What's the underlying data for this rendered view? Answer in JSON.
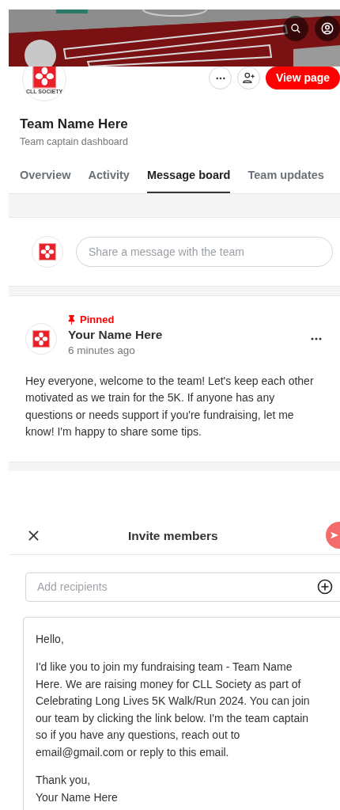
{
  "team": {
    "logo_caption": "CLL SOCIETY",
    "view_button": "View page",
    "name": "Team Name Here",
    "subtitle": "Team captain dashboard"
  },
  "tabs": [
    {
      "label": "Overview",
      "selected": false
    },
    {
      "label": "Activity",
      "selected": false
    },
    {
      "label": "Message board",
      "selected": true
    },
    {
      "label": "Team updates",
      "selected": false
    }
  ],
  "composer": {
    "placeholder": "Share a message with the team"
  },
  "post": {
    "pinned": true,
    "pinned_label": "Pinned",
    "author": "Your Name Here",
    "time": "6 minutes ago",
    "body": "Hey everyone, welcome to the team! Let's keep each other motivated as we train for the 5K. If anyone has any questions or needs support if you're fundraising, let me know! I'm happy to share some tips."
  },
  "invite": {
    "title": "Invite members",
    "recipients_placeholder": "Add recipients",
    "message": [
      [
        "Hello,"
      ],
      [
        "I'd like you to join my fundraising team - Team Name Here. We are raising money for CLL Society as part of Celebrating Long Lives 5K Walk/Run 2024. You can join our team by clicking the link below. I'm the team captain so if you have any questions, reach out to email@gmail.com or reply to this email."
      ],
      [
        "Thank you,",
        "Your Name Here"
      ]
    ]
  }
}
